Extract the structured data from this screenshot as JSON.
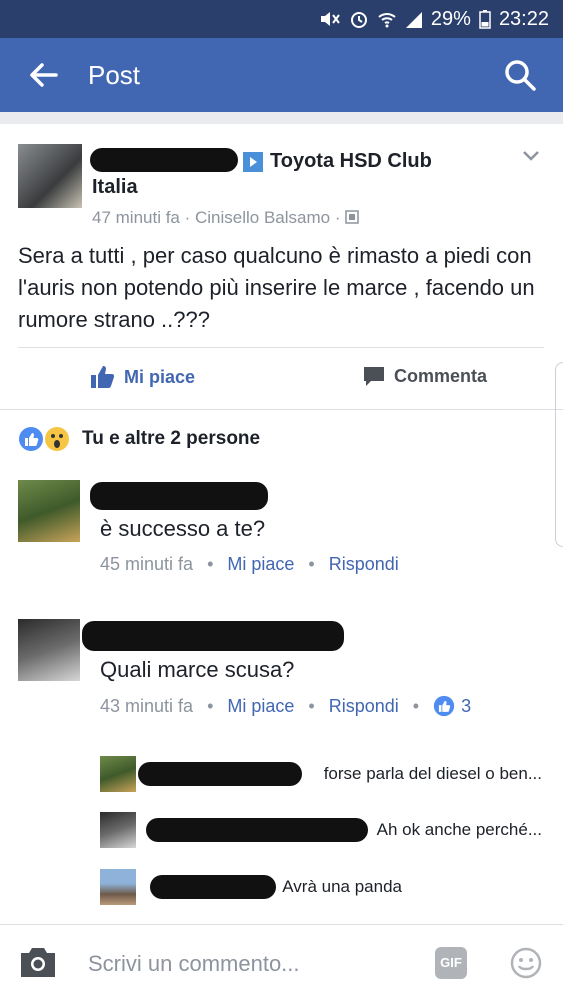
{
  "status": {
    "battery": "29%",
    "time": "23:22"
  },
  "appbar": {
    "title": "Post"
  },
  "post": {
    "group_line1": "Toyota HSD Club",
    "group_line2": "Italia",
    "meta": "47 minuti fa · Cinisello Balsamo ·",
    "text": "Sera a tutti , per caso qualcuno è rimasto a piedi con l'auris non potendo più inserire le marce , facendo un rumore strano ..???"
  },
  "actions": {
    "like": "Mi piace",
    "comment": "Commenta"
  },
  "reactions": {
    "summary": "Tu e altre 2 persone"
  },
  "comments": [
    {
      "text": "è successo a te?",
      "time": "45 minuti fa",
      "like": "Mi piace",
      "reply": "Rispondi"
    },
    {
      "text": "Quali marce scusa?",
      "time": "43 minuti fa",
      "like": "Mi piace",
      "reply": "Rispondi",
      "likes": "3"
    }
  ],
  "replies": [
    {
      "text": "forse parla del diesel o ben..."
    },
    {
      "text": "Ah ok anche perché..."
    },
    {
      "text": "Avrà una panda"
    }
  ],
  "composer": {
    "placeholder": "Scrivi un commento...",
    "gif": "GIF"
  },
  "colors": {
    "brand": "#4267b2",
    "status_bar": "#2a3f6b"
  }
}
